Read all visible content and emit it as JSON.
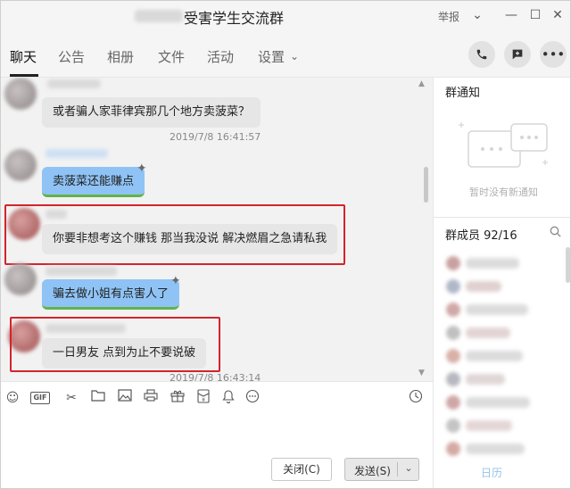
{
  "window": {
    "title": "受害学生交流群",
    "report": "举报"
  },
  "tabs": [
    {
      "label": "聊天",
      "active": true
    },
    {
      "label": "公告",
      "active": false
    },
    {
      "label": "相册",
      "active": false
    },
    {
      "label": "文件",
      "active": false
    },
    {
      "label": "活动",
      "active": false
    },
    {
      "label": "设置",
      "active": false
    }
  ],
  "messages": [
    {
      "text": "或者骗人家菲律宾那几个地方卖菠菜？"
    },
    {
      "text": "卖菠菜还能赚点"
    },
    {
      "text": "你要非想考这个赚钱 那当我没说 解决燃眉之急请私我"
    },
    {
      "text": "骗去做小姐有点害人了"
    },
    {
      "text": "一日男友 点到为止不要说破"
    }
  ],
  "timestamps": [
    "2019/7/8 16:41:57",
    "2019/7/8 16:43:14"
  ],
  "input": {
    "close_label": "关闭(C)",
    "send_label": "发送(S)"
  },
  "right_panel": {
    "notice_title": "群通知",
    "notice_empty": "暂时没有新通知",
    "members_title": "群成员 92/16"
  },
  "colors": {
    "accent_red": "#d3242b",
    "bubble_blue": "#8fc3f5",
    "bubble_gray": "#e6e6e6"
  },
  "icons": [
    "phone-icon",
    "add-chat-icon",
    "more-icon",
    "emoji-icon",
    "gif-icon",
    "scissors-icon",
    "folder-icon",
    "image-icon",
    "print-icon",
    "gift-icon",
    "red-packet-icon",
    "bell-icon",
    "poll-icon",
    "history-icon",
    "search-icon"
  ],
  "corner_label": "日历"
}
